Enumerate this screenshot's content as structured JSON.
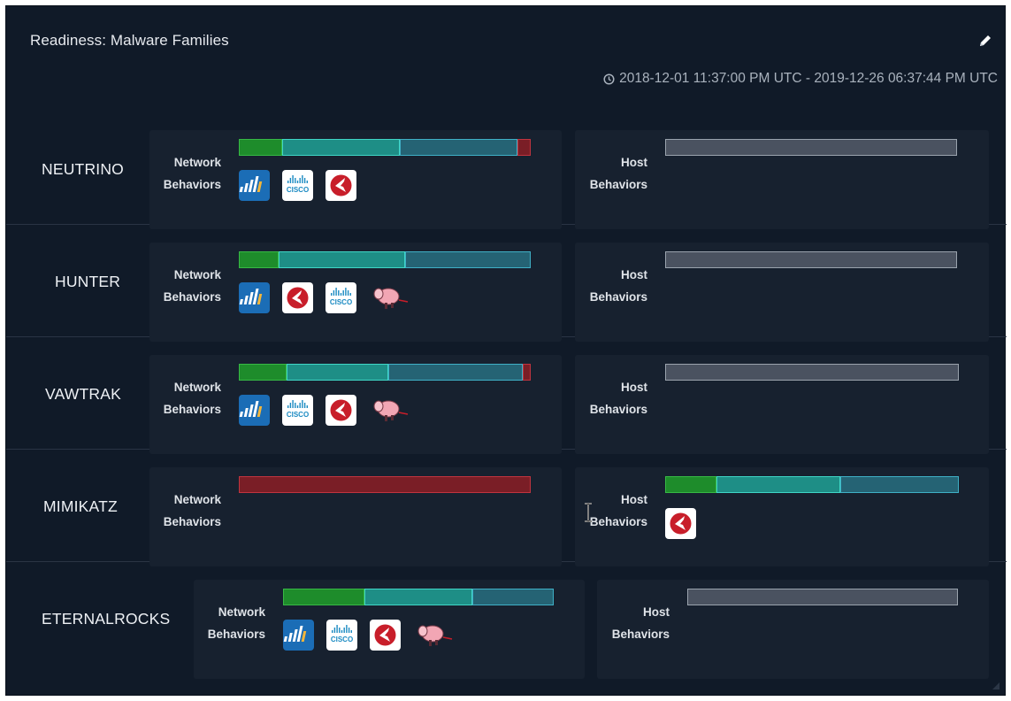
{
  "panel": {
    "title": "Readiness: Malware Families",
    "time_range": "2018-12-01 11:37:00 PM UTC - 2019-12-26 06:37:44 PM UTC"
  },
  "labels": {
    "network_1": "Network",
    "network_2": "Behaviors",
    "host_1": "Host",
    "host_2": "Behaviors"
  },
  "rows": [
    {
      "name": "NEUTRINO",
      "network_bar": [
        {
          "kind": "green",
          "fraction": 0.148
        },
        {
          "kind": "teal",
          "fraction": 0.403
        },
        {
          "kind": "slate",
          "fraction": 0.404
        },
        {
          "kind": "red",
          "fraction": 0.045
        }
      ],
      "network_icons": [
        "palo-alto-icon",
        "cisco-icon",
        "cylance-icon"
      ],
      "host_bar": [
        {
          "kind": "gray",
          "fraction": 1.0
        }
      ],
      "host_icons": []
    },
    {
      "name": "HUNTER",
      "network_bar": [
        {
          "kind": "green",
          "fraction": 0.137
        },
        {
          "kind": "teal",
          "fraction": 0.432
        },
        {
          "kind": "slate",
          "fraction": 0.431
        }
      ],
      "network_icons": [
        "palo-alto-icon",
        "cylance-icon",
        "cisco-icon",
        "snort-pig-icon"
      ],
      "host_bar": [
        {
          "kind": "gray",
          "fraction": 1.0
        }
      ],
      "host_icons": []
    },
    {
      "name": "VAWTRAK",
      "network_bar": [
        {
          "kind": "green",
          "fraction": 0.163
        },
        {
          "kind": "teal",
          "fraction": 0.35
        },
        {
          "kind": "slate",
          "fraction": 0.46
        },
        {
          "kind": "red",
          "fraction": 0.027
        }
      ],
      "network_icons": [
        "palo-alto-icon",
        "cisco-icon",
        "cylance-icon",
        "snort-pig-icon"
      ],
      "host_bar": [
        {
          "kind": "gray",
          "fraction": 1.0
        }
      ],
      "host_icons": []
    },
    {
      "name": "MIMIKATZ",
      "network_bar": [
        {
          "kind": "red",
          "fraction": 1.0
        }
      ],
      "network_icons": [],
      "host_bar": [
        {
          "kind": "green",
          "fraction": 0.175
        },
        {
          "kind": "teal",
          "fraction": 0.42
        },
        {
          "kind": "slate",
          "fraction": 0.405
        }
      ],
      "host_icons": [
        "cylance-icon"
      ]
    },
    {
      "name": "ETERNALROCKS",
      "network_bar": [
        {
          "kind": "green",
          "fraction": 0.3
        },
        {
          "kind": "teal",
          "fraction": 0.4
        },
        {
          "kind": "slate",
          "fraction": 0.3
        }
      ],
      "network_icons": [
        "palo-alto-icon",
        "cisco-icon",
        "cylance-icon",
        "snort-pig-icon"
      ],
      "host_bar": [
        {
          "kind": "gray",
          "fraction": 1.0
        }
      ],
      "host_icons": []
    }
  ],
  "colors": {
    "panel_bg": "#101a28",
    "card_bg": "#17212f",
    "green": "#1e8c2b",
    "teal": "#1e8e86",
    "slate": "#256374",
    "red": "#7a1e26",
    "gray": "#4a5260"
  }
}
